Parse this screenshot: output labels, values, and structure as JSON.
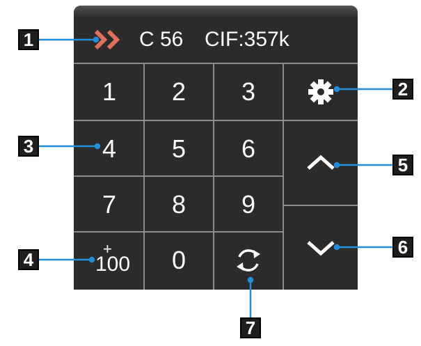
{
  "status": {
    "channel": "C 56",
    "cif": "CIF:357k"
  },
  "keys": [
    "1",
    "2",
    "3",
    "4",
    "5",
    "6",
    "7",
    "8",
    "9",
    "0"
  ],
  "plus100": {
    "plus": "+",
    "value": "100"
  },
  "callouts": [
    "1",
    "2",
    "3",
    "4",
    "5",
    "6",
    "7"
  ],
  "icons": {
    "status": "double-chevron-right-icon",
    "settings": "gear-icon",
    "up": "chevron-up-icon",
    "down": "chevron-down-icon",
    "refresh": "refresh-cycle-icon"
  },
  "colors": {
    "panel": "#2b2b2b",
    "grid": "#8a8a8a",
    "chevron": "#e0705a",
    "leader": "#1e8fd8",
    "text": "#ffffff"
  }
}
